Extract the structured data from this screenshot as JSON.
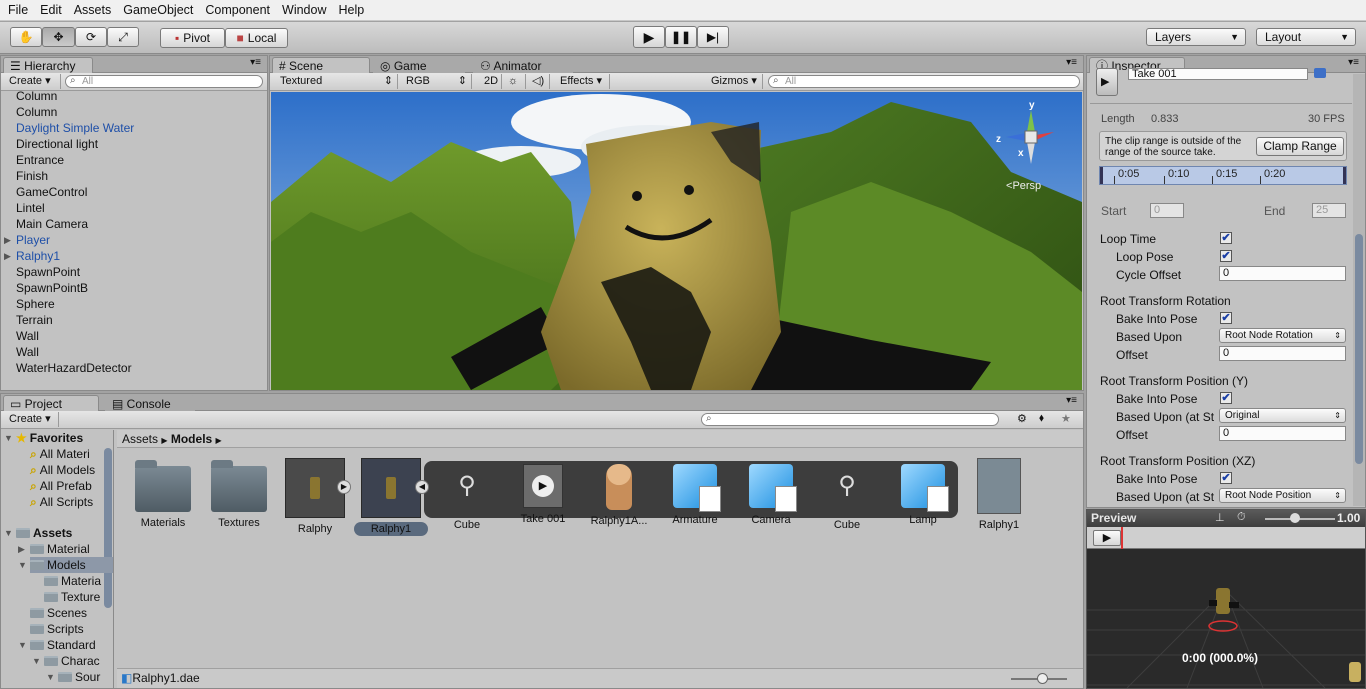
{
  "menu": [
    "File",
    "Edit",
    "Assets",
    "GameObject",
    "Component",
    "Window",
    "Help"
  ],
  "toolbar": {
    "pivot": "Pivot",
    "local": "Local",
    "layers": "Layers",
    "layout": "Layout"
  },
  "hierarchy": {
    "tab": "Hierarchy",
    "create": "Create",
    "search_placeholder": "All",
    "items": [
      "Column",
      "Column",
      "Daylight Simple Water",
      "Directional light",
      "Entrance",
      "Finish",
      "GameControl",
      "Lintel",
      "Main Camera",
      "Player",
      "Ralphy1",
      "SpawnPoint",
      "SpawnPointB",
      "Sphere",
      "Terrain",
      "Wall",
      "Wall",
      "WaterHazardDetector"
    ]
  },
  "scene": {
    "tabs": [
      "Scene",
      "Game",
      "Animator"
    ],
    "render_mode": "Textured",
    "color_mode": "RGB",
    "mode_2d": "2D",
    "effects": "Effects",
    "gizmos": "Gizmos",
    "search_placeholder": "All",
    "persp": "Persp",
    "axis_y": "y",
    "axis_x": "x",
    "axis_z": "z"
  },
  "project": {
    "tabs": [
      "Project",
      "Console"
    ],
    "create": "Create",
    "favorites_label": "Favorites",
    "favorites": [
      "All Materi",
      "All Models",
      "All Prefab",
      "All Scripts"
    ],
    "assets_label": "Assets",
    "tree": [
      "Material",
      "Models",
      "Materia",
      "Texture",
      "Scenes",
      "Scripts",
      "Standard",
      "Charac",
      "Sour"
    ],
    "breadcrumb": [
      "Assets",
      "Models"
    ],
    "assets": [
      "Materials",
      "Textures",
      "Ralphy",
      "Ralphy1",
      "Cube",
      "Take 001",
      "Ralphy1A...",
      "Armature",
      "Camera",
      "Cube",
      "Lamp",
      "Ralphy1"
    ],
    "status_file": "Ralphy1.dae"
  },
  "inspector": {
    "tab": "Inspector",
    "take": "Take 001",
    "length_label": "Length",
    "length": "0.833",
    "fps": "30 FPS",
    "warning": "The clip range is outside of the range of the source take.",
    "clamp": "Clamp Range",
    "ticks": [
      "0:05",
      "0:10",
      "0:15",
      "0:20"
    ],
    "start_label": "Start",
    "start": "0",
    "end_label": "End",
    "end": "25",
    "loop_time": "Loop Time",
    "loop_pose": "Loop Pose",
    "cycle_offset": "Cycle Offset",
    "cycle_offset_val": "0",
    "rot_header": "Root Transform Rotation",
    "bake": "Bake Into Pose",
    "based_upon": "Based Upon",
    "rot_based": "Root Node Rotation",
    "offset": "Offset",
    "rot_offset": "0",
    "posy_header": "Root Transform Position (Y)",
    "based_upon_st": "Based Upon (at St",
    "posy_based": "Original",
    "posy_offset": "0",
    "posxz_header": "Root Transform Position (XZ)",
    "posxz_based": "Root Node Position"
  },
  "preview": {
    "label": "Preview",
    "speed": "1.00",
    "time": "0:00 (000.0%)"
  }
}
